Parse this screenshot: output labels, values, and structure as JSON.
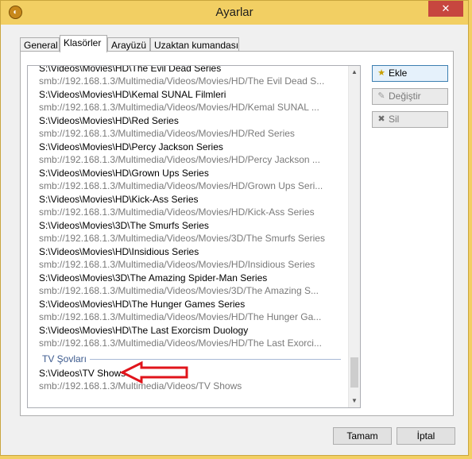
{
  "window": {
    "title": "Ayarlar",
    "close_glyph": "✕",
    "app_icon": "app-icon"
  },
  "tabs": [
    {
      "label": "General",
      "active": false
    },
    {
      "label": "Klasörler",
      "active": true
    },
    {
      "label": "Arayüzü",
      "active": false
    },
    {
      "label": "Uzaktan kumandası",
      "active": false
    }
  ],
  "folders": {
    "entries": [
      {
        "path": "S:\\Videos\\Movies\\HD\\The Evil Dead Series",
        "url": "smb://192.168.1.3/Multimedia/Videos/Movies/HD/The Evil Dead S..."
      },
      {
        "path": "S:\\Videos\\Movies\\HD\\Kemal SUNAL Filmleri",
        "url": "smb://192.168.1.3/Multimedia/Videos/Movies/HD/Kemal SUNAL ..."
      },
      {
        "path": "S:\\Videos\\Movies\\HD\\Red Series",
        "url": "smb://192.168.1.3/Multimedia/Videos/Movies/HD/Red Series"
      },
      {
        "path": "S:\\Videos\\Movies\\HD\\Percy Jackson Series",
        "url": "smb://192.168.1.3/Multimedia/Videos/Movies/HD/Percy Jackson ..."
      },
      {
        "path": "S:\\Videos\\Movies\\HD\\Grown Ups Series",
        "url": "smb://192.168.1.3/Multimedia/Videos/Movies/HD/Grown Ups Seri..."
      },
      {
        "path": "S:\\Videos\\Movies\\HD\\Kick-Ass Series",
        "url": "smb://192.168.1.3/Multimedia/Videos/Movies/HD/Kick-Ass Series"
      },
      {
        "path": "S:\\Videos\\Movies\\3D\\The Smurfs Series",
        "url": "smb://192.168.1.3/Multimedia/Videos/Movies/3D/The Smurfs Series"
      },
      {
        "path": "S:\\Videos\\Movies\\HD\\Insidious Series",
        "url": "smb://192.168.1.3/Multimedia/Videos/Movies/HD/Insidious Series"
      },
      {
        "path": "S:\\Videos\\Movies\\3D\\The Amazing Spider-Man Series",
        "url": "smb://192.168.1.3/Multimedia/Videos/Movies/3D/The Amazing S..."
      },
      {
        "path": "S:\\Videos\\Movies\\HD\\The Hunger Games Series",
        "url": "smb://192.168.1.3/Multimedia/Videos/Movies/HD/The Hunger Ga..."
      },
      {
        "path": "S:\\Videos\\Movies\\HD\\The Last Exorcism Duology",
        "url": "smb://192.168.1.3/Multimedia/Videos/Movies/HD/The Last Exorci..."
      }
    ],
    "group_label": "TV Şovları",
    "group_entries": [
      {
        "path": "S:\\Videos\\TV Shows",
        "url": "smb://192.168.1.3/Multimedia/Videos/TV Shows"
      }
    ],
    "scrollbar": {
      "up_glyph": "▲",
      "down_glyph": "▼"
    }
  },
  "buttons": {
    "add": "Ekle",
    "change": "Değiştir",
    "remove": "Sil",
    "ok": "Tamam",
    "cancel": "İptal"
  },
  "icons": {
    "add": "folder-add-icon",
    "change": "edit-icon",
    "remove": "remove-icon"
  },
  "colors": {
    "titlebar": "#f2cf63",
    "close": "#c7463f",
    "group_header": "#3c5a8e",
    "annotation_arrow": "#e0141b"
  }
}
